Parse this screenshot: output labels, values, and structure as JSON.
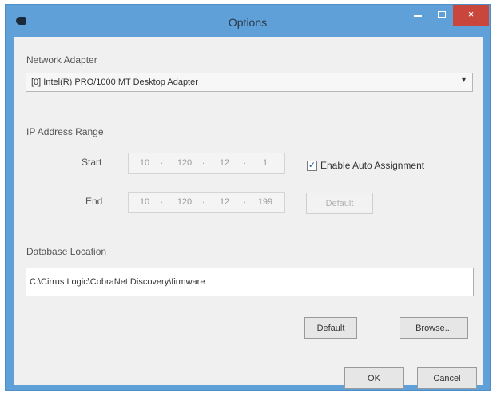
{
  "window": {
    "title": "Options",
    "close_glyph": "×"
  },
  "network_adapter": {
    "label": "Network Adapter",
    "selected": "[0] Intel(R) PRO/1000 MT Desktop Adapter",
    "arrow_glyph": "▾"
  },
  "ip_range": {
    "label": "IP Address Range",
    "start_label": "Start",
    "start": [
      "10",
      "120",
      "12",
      "1"
    ],
    "end_label": "End",
    "end": [
      "10",
      "120",
      "12",
      "199"
    ],
    "separator": "."
  },
  "auto_assign": {
    "label": "Enable Auto Assignment",
    "checked": true,
    "check_glyph": "✓"
  },
  "range_default_button": "Default",
  "database": {
    "label": "Database Location",
    "path": "C:\\Cirrus Logic\\CobraNet Discovery\\firmware"
  },
  "db_default_button": "Default",
  "browse_button": "Browse...",
  "ok_button": "OK",
  "cancel_button": "Cancel"
}
